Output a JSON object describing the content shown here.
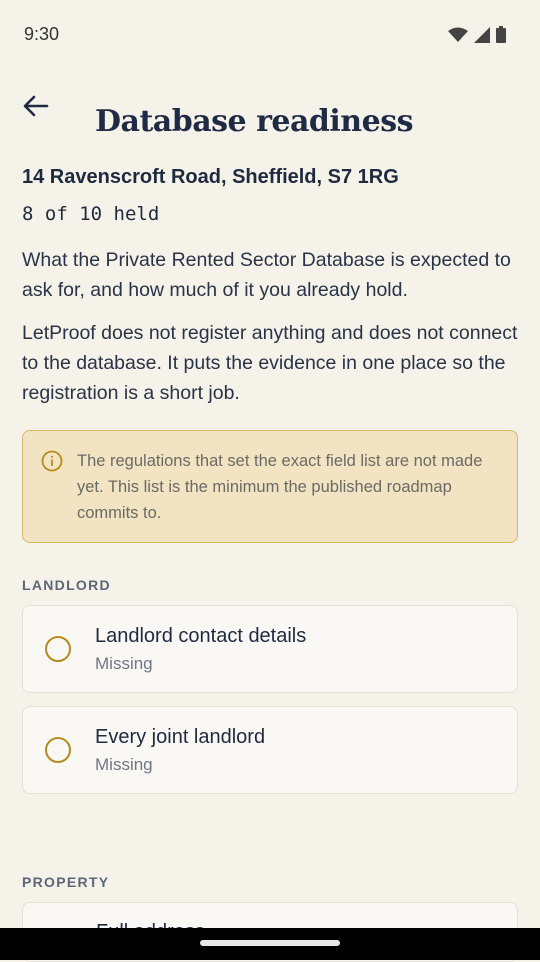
{
  "status": {
    "time": "9:30"
  },
  "header": {
    "title": "Database readiness"
  },
  "property": {
    "address": "14 Ravenscroft Road, Sheffield, S7 1RG",
    "held_summary": "8 of 10 held"
  },
  "intro": {
    "paragraph1": "What the Private Rented Sector Database is expected to ask for, and how much of it you already hold.",
    "paragraph2": "LetProof does not register anything and does not connect to the database. It puts the evidence in one place so the registration is a short job."
  },
  "notice": {
    "icon": "info-icon",
    "text": "The regulations that set the exact field list are not made yet. This list is the minimum the published roadmap commits to."
  },
  "sections": {
    "landlord": {
      "label": "LANDLORD",
      "items": [
        {
          "title": "Landlord contact details",
          "status": "Missing"
        },
        {
          "title": "Every joint landlord",
          "status": "Missing"
        }
      ]
    },
    "property": {
      "label": "PROPERTY",
      "items": [
        {
          "title": "Full address"
        }
      ]
    }
  },
  "colors": {
    "background": "#f5f2ea",
    "notice_bg": "#f2e4c2",
    "notice_border": "#d9b863",
    "status_circle": "#b88a1b",
    "title": "#1f2a44"
  }
}
